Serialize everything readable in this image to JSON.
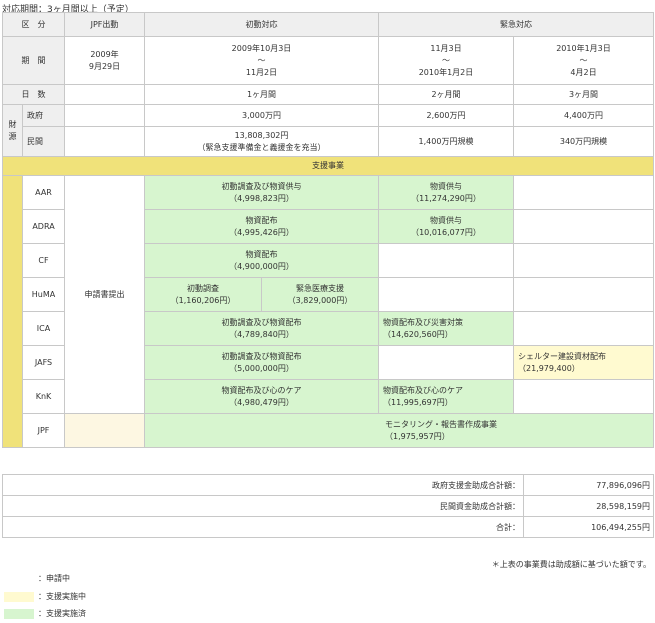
{
  "title": "対応期間：3ヶ月間以上（予定）",
  "header": {
    "category": "区　分",
    "jpf": "JPF出動",
    "initial": "初動対応",
    "emergency": "緊急対応"
  },
  "period": {
    "label": "期　間",
    "jpf": "2009年\n9月29日",
    "initial": "2009年10月3日\n～\n11月2日",
    "emg1": "11月3日\n～\n2010年1月2日",
    "emg2": "2010年1月3日\n～\n4月2日"
  },
  "days": {
    "label": "日　数",
    "initial": "1ヶ月間",
    "emg1": "2ヶ月間",
    "emg2": "3ヶ月間"
  },
  "funding": {
    "label": "財\n源",
    "gov": {
      "label": "政府",
      "initial": "3,000万円",
      "emg1": "2,600万円",
      "emg2": "4,400万円"
    },
    "private": {
      "label": "民間",
      "initial": "13,808,302円\n（緊急支援準備金と義援金を充当）",
      "emg1": "1,400万円規模",
      "emg2": "340万円規模"
    }
  },
  "support_header": "支援事業",
  "apply": "申請書提出",
  "orgs": {
    "aar": {
      "name": "AAR",
      "c1": "初動調査及び物資供与\n（4,998,823円）",
      "c2": "物資供与\n（11,274,290円）"
    },
    "adra": {
      "name": "ADRA",
      "c1": "物資配布\n（4,995,426円）",
      "c2": "物資供与\n（10,016,077円）"
    },
    "cf": {
      "name": "CF",
      "c1": "物資配布\n（4,900,000円）"
    },
    "huma": {
      "name": "HuMA",
      "c1a": "初動調査\n（1,160,206円）",
      "c1b": "緊急医療支援\n（3,829,000円）"
    },
    "ica": {
      "name": "ICA",
      "c1": "初動調査及び物資配布\n（4,789,840円）",
      "c2": "物資配布及び災害対策\n（14,620,560円）"
    },
    "jafs": {
      "name": "JAFS",
      "c1": "初動調査及び物資配布\n（5,000,000円）",
      "c3": "シェルター建設資材配布\n（21,979,400）"
    },
    "knk": {
      "name": "KnK",
      "c1": "物資配布及び心のケア\n（4,980,479円）",
      "c2": "物資配布及び心のケア\n（11,995,697円）"
    },
    "jpf": {
      "name": "JPF",
      "c2": "モニタリング・報告書作成事業\n（1,975,957円）"
    }
  },
  "totals": [
    {
      "label": "政府支援金助成合計額：",
      "value": "77,896,096円"
    },
    {
      "label": "民間資金助成合計額：",
      "value": "28,598,159円"
    },
    {
      "label": "合計：",
      "value": "106,494,255円"
    }
  ],
  "note": "＊上表の事業費は助成額に基づいた額です。",
  "legend": [
    {
      "label": "：申請中",
      "color": "#ffffff"
    },
    {
      "label": "：支援実施中",
      "color": "#fffad0"
    },
    {
      "label": "：支援実施済",
      "color": "#d7f5cf"
    }
  ]
}
